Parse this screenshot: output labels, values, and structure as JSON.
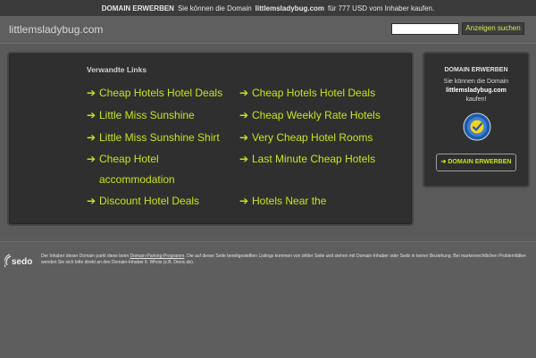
{
  "topbar": {
    "label": "DOMAIN ERWERBEN",
    "text_before": "Sie können die Domain",
    "domain": "littlemsladybug.com",
    "text_after": "für 777 USD vom Inhaber kaufen."
  },
  "header": {
    "site_title": "littlemsladybug.com",
    "search": {
      "placeholder": "",
      "value": ""
    },
    "search_button": "Anzeigen suchen"
  },
  "links": {
    "heading": "Verwandte Links",
    "arrow_glyph": "➔",
    "items": [
      "Cheap Hotels Hotel Deals",
      "Cheap Hotels Hotel Deals",
      "Little Miss Sunshine",
      "Cheap Weekly Rate Hotels",
      "Little Miss Sunshine Shirt",
      "Very Cheap Hotel Rooms",
      "Cheap Hotel",
      "accommodation",
      "Last Minute Cheap Hotels",
      "Discount Hotel Deals",
      "Hotels Near the"
    ]
  },
  "domain_panel": {
    "title": "DOMAIN ERWERBEN",
    "line1": "Sie können die Domain",
    "domain": "littlemsladybug.com",
    "line3": "kaufen!",
    "button": "➔ DOMAIN ERWERBEN"
  },
  "footer": {
    "logo": "sedo",
    "d1": "Der Inhaber dieser Domain parkt diese beim",
    "d_link": "Domain-Parking-Programm",
    "d2": ". Die auf dieser Seite bereitgestellten Listings kommen von dritter Seite und stehen mit Domain-Inhaber oder Sedo in keiner Beziehung. Bei markenrechtlichen Problemfällen wenden Sie sich bitte direkt an den Domain-Inhaber lt. Whois (z.B. Denic.de)."
  },
  "colors": {
    "accent": "#c9e31a",
    "topbar_bg": "#3b3b3b",
    "panel_bg": "#2f2f2f",
    "page_bg": "#5b5b5b"
  }
}
